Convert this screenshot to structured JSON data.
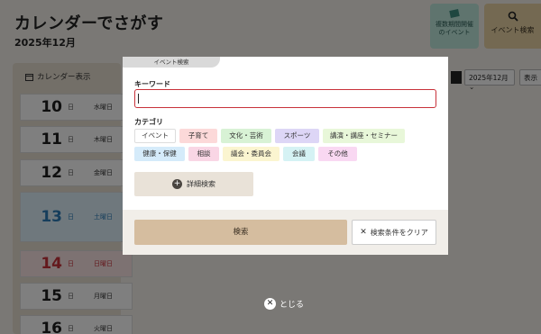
{
  "header": {
    "title": "カレンダーでさがす",
    "month": "2025年12月"
  },
  "top_buttons": {
    "multi_period_label": "複数期間開催\nのイベント",
    "event_search_label": "イベント検索"
  },
  "calendar": {
    "tab_label": "カレンダー表示",
    "month_select_value": "2025年12月",
    "display_button": "表示",
    "days": [
      {
        "num": "10",
        "nichi": "日",
        "weekday": "水曜日",
        "type": "weekday"
      },
      {
        "num": "11",
        "nichi": "日",
        "weekday": "木曜日",
        "type": "weekday"
      },
      {
        "num": "12",
        "nichi": "日",
        "weekday": "金曜日",
        "type": "weekday"
      },
      {
        "num": "13",
        "nichi": "日",
        "weekday": "土曜日",
        "type": "sat"
      },
      {
        "num": "14",
        "nichi": "日",
        "weekday": "日曜日",
        "type": "sun"
      },
      {
        "num": "15",
        "nichi": "日",
        "weekday": "月曜日",
        "type": "weekday"
      },
      {
        "num": "16",
        "nichi": "日",
        "weekday": "火曜日",
        "type": "weekday"
      }
    ]
  },
  "modal": {
    "tab_title": "イベント検索",
    "keyword_label": "キーワード",
    "keyword_value": "",
    "category_label": "カテゴリ",
    "categories": [
      "イベント",
      "子育て",
      "文化・芸術",
      "スポーツ",
      "講演・講座・セミナー",
      "健康・保健",
      "相談",
      "議会・委員会",
      "会議",
      "その他"
    ],
    "advanced_label": "詳細検索",
    "search_label": "検索",
    "clear_label": "検索条件をクリア"
  },
  "close_label": "とじる",
  "colors": {
    "accent_red": "#c8323a",
    "search_button": "#d5bd9f",
    "saturday_blue": "#2d7db8"
  }
}
